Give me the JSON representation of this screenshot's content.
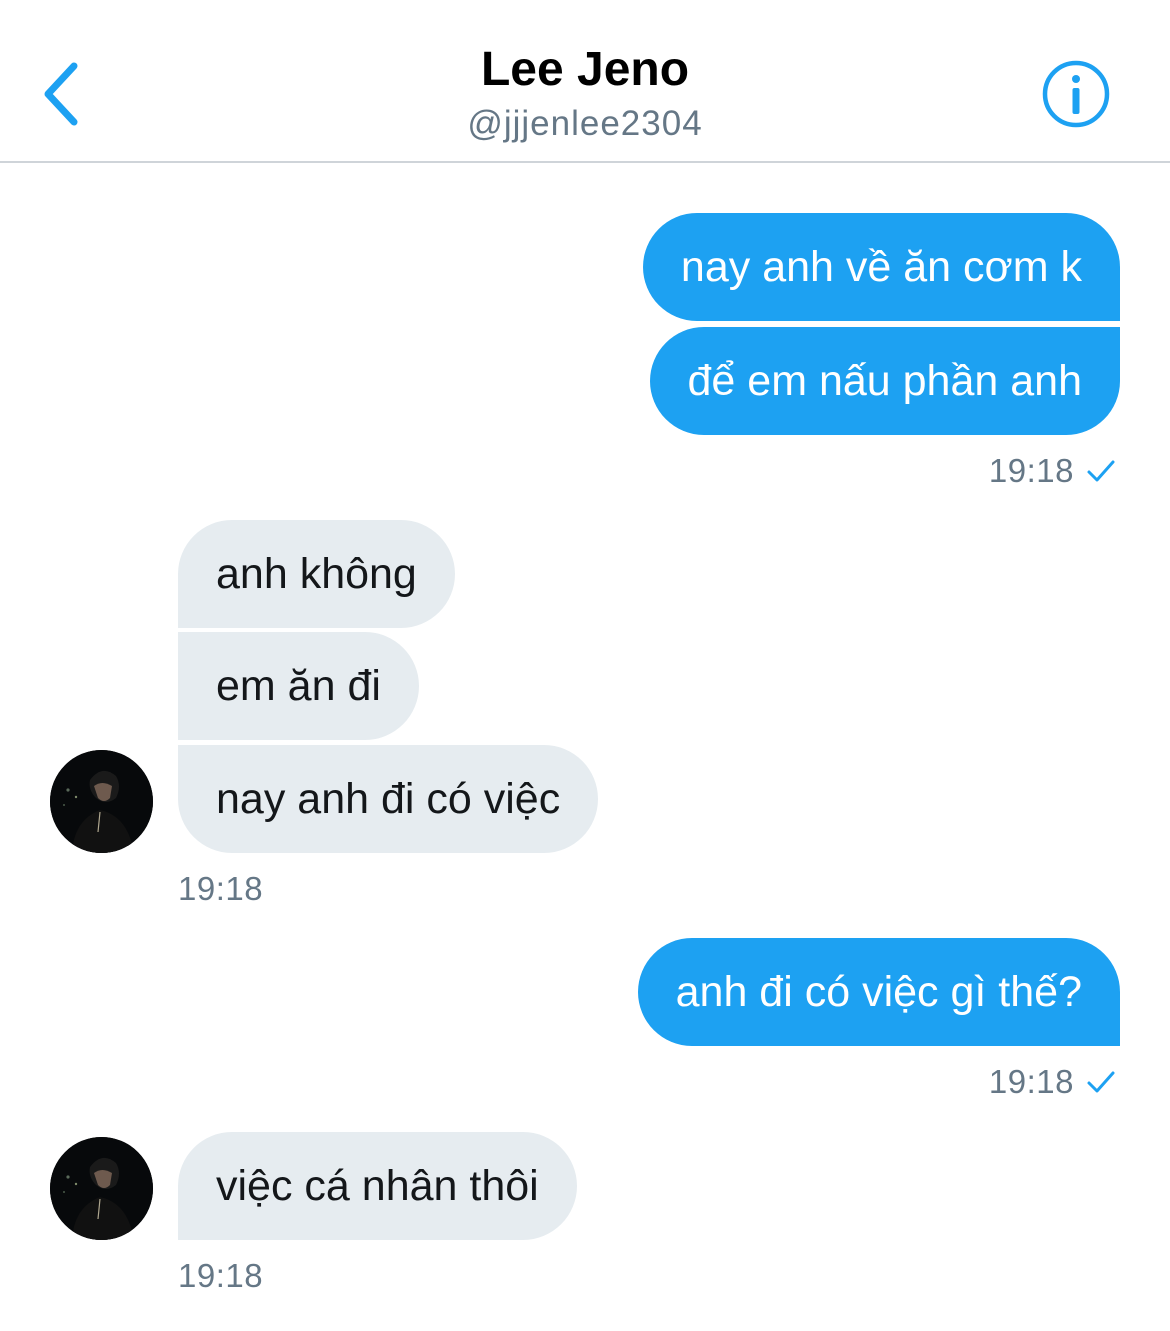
{
  "header": {
    "name": "Lee Jeno",
    "handle": "@jjjenlee2304",
    "back_icon": "chevron-left-icon",
    "info_icon": "info-circle-icon"
  },
  "colors": {
    "accent": "#1da1f2",
    "incoming_bubble": "#e6ecf0",
    "timestamp": "#657786"
  },
  "messages": [
    {
      "text": "nay anh về ăn cơm k"
    },
    {
      "text": "để em nấu phần anh"
    },
    {
      "timestamp": "19:18",
      "status": "sent"
    },
    {
      "text": "anh không"
    },
    {
      "text": "em ăn đi"
    },
    {
      "text": "nay anh đi có việc"
    },
    {
      "timestamp": "19:18"
    },
    {
      "text": "anh đi có việc gì thế?"
    },
    {
      "timestamp": "19:18",
      "status": "sent"
    },
    {
      "text": "việc cá nhân thôi"
    },
    {
      "timestamp": "19:18"
    }
  ]
}
